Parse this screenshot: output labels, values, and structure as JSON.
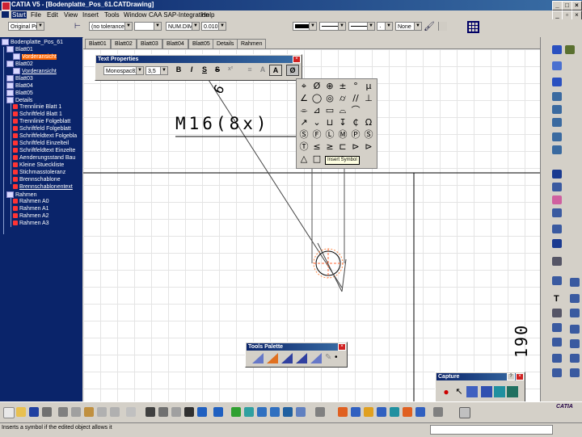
{
  "window": {
    "title": "CATIA V5 - [Bodenplatte_Pos_61.CATDrawing]",
    "minimize": "_",
    "maximize": "□",
    "close": "×"
  },
  "menu": [
    "Start",
    "File",
    "Edit",
    "View",
    "Insert",
    "Tools",
    "Window",
    "CAA SAP-Integration",
    "Help"
  ],
  "toolbar": {
    "standard_select": "Original Pro",
    "tolerance": "(no tolerance)",
    "tolerance2": "",
    "dim_format": "NUM.DIMM",
    "precision": "0.010",
    "line_weight_field": "",
    "line_type_field": "",
    "thickness_field": "",
    "pattern": "None"
  },
  "tree": {
    "root": "Bodenplatte_Pos_61",
    "items": [
      {
        "label": "Blatt01",
        "level": 1,
        "type": "sheet"
      },
      {
        "label": "Vorderansicht",
        "level": 2,
        "type": "view",
        "selected": true
      },
      {
        "label": "Blatt02",
        "level": 1,
        "type": "sheet"
      },
      {
        "label": "Vorderansicht",
        "level": 2,
        "type": "view",
        "link": true
      },
      {
        "label": "Blatt03",
        "level": 1,
        "type": "sheet"
      },
      {
        "label": "Blatt04",
        "level": 1,
        "type": "sheet"
      },
      {
        "label": "Blatt05",
        "level": 1,
        "type": "sheet"
      },
      {
        "label": "Details",
        "level": 1,
        "type": "sheet"
      },
      {
        "label": "Trennlinie Blatt 1",
        "level": 2,
        "type": "detail"
      },
      {
        "label": "Schriftfeld Blatt 1",
        "level": 2,
        "type": "detail"
      },
      {
        "label": "Trennlinie Folgeblatt",
        "level": 2,
        "type": "detail"
      },
      {
        "label": "Schriftfeld Folgeblatt",
        "level": 2,
        "type": "detail"
      },
      {
        "label": "Schriftfeldtext Folgebla",
        "level": 2,
        "type": "detail"
      },
      {
        "label": "Schriftfeld Einzelteil",
        "level": 2,
        "type": "detail"
      },
      {
        "label": "Schriftfeldtext Einzelte",
        "level": 2,
        "type": "detail"
      },
      {
        "label": "Aenderungsstand Bau",
        "level": 2,
        "type": "detail"
      },
      {
        "label": "Kleine Stueckliste",
        "level": 2,
        "type": "detail"
      },
      {
        "label": "Stichmasstoleranz",
        "level": 2,
        "type": "detail"
      },
      {
        "label": "Brennschablone",
        "level": 2,
        "type": "detail"
      },
      {
        "label": "Brennschablonentext",
        "level": 2,
        "type": "detail",
        "link": true
      },
      {
        "label": "Rahmen",
        "level": 1,
        "type": "sheet"
      },
      {
        "label": "Rahmen A0",
        "level": 2,
        "type": "detail"
      },
      {
        "label": "Rahmen A1",
        "level": 2,
        "type": "detail"
      },
      {
        "label": "Rahmen A2",
        "level": 2,
        "type": "detail"
      },
      {
        "label": "Rahmen A3",
        "level": 2,
        "type": "detail"
      }
    ]
  },
  "tabs": [
    "Blatt01",
    "Blatt02",
    "Blatt03",
    "Blatt04",
    "Blatt05",
    "Details",
    "Rahmen"
  ],
  "text_properties": {
    "title": "Text Properties",
    "font": "Monospac821",
    "size": "3,5",
    "bold": "B",
    "italic": "I",
    "underline": "S",
    "strike": "S",
    "superscript": "x²",
    "frame": "A",
    "symbol": "Ø"
  },
  "symbols": {
    "rows": [
      [
        "⌖",
        "Ø",
        "⊕",
        "±",
        "°",
        "μ"
      ],
      [
        "∠",
        "◯",
        "◎",
        "⌭",
        "//",
        "⊥"
      ],
      [
        "⌯",
        "⊿",
        "▭",
        "⌓",
        "⌒",
        ""
      ],
      [
        "↗",
        "⌄",
        "⊔",
        "↧",
        "₵",
        "Ω"
      ],
      [
        "Ⓢ",
        "Ⓕ",
        "Ⓛ",
        "Ⓜ",
        "Ⓟ",
        "Ⓢ"
      ],
      [
        "Ⓣ",
        "≤",
        "≥",
        "⊏",
        "⊳",
        "⊳"
      ],
      [
        "△",
        "□",
        "",
        "",
        "",
        ""
      ]
    ],
    "tooltip": "Insert Symbol"
  },
  "drawing": {
    "thread_label": "M16(8x)",
    "rotated_label": "6",
    "dim_label": "190"
  },
  "tools_palette": {
    "title": "Tools Palette"
  },
  "capture": {
    "title": "Capture",
    "help": "?",
    "close": "×"
  },
  "status": {
    "text": "Inserts a symbol if the edited object allows it",
    "brand": "CATIA"
  }
}
